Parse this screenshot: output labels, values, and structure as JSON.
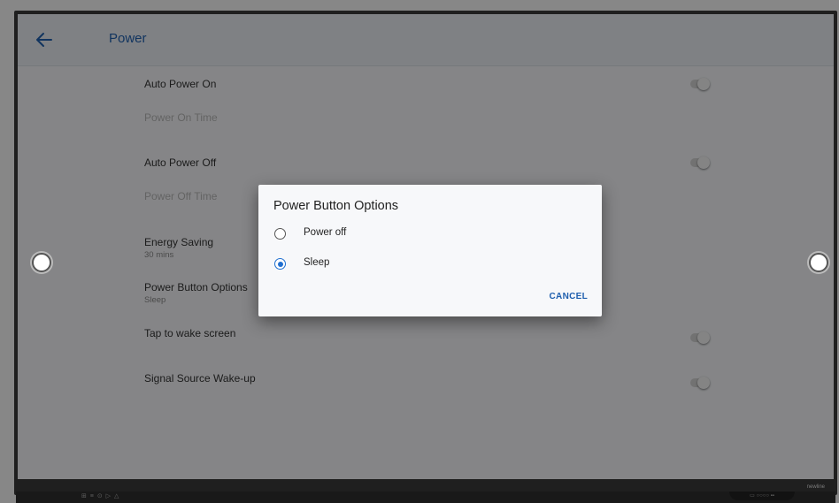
{
  "header": {
    "title": "Power",
    "back_icon": "arrow-left-icon"
  },
  "settings": {
    "auto_power_on": "Auto Power On",
    "power_on_time": "Power On Time",
    "auto_power_off": "Auto Power Off",
    "power_off_time": "Power Off Time",
    "energy_saving": "Energy Saving",
    "energy_saving_value": "30 mins",
    "power_button_options": "Power Button Options",
    "power_button_value": "Sleep",
    "tap_to_wake": "Tap to wake screen",
    "signal_wake": "Signal Source Wake-up"
  },
  "dialog": {
    "title": "Power Button Options",
    "options": [
      {
        "label": "Power off",
        "selected": false
      },
      {
        "label": "Sleep",
        "selected": true
      }
    ],
    "cancel_label": "CANCEL"
  },
  "device": {
    "brand": "newline",
    "bottom_icons": "⊞ ≡ ⊙ ▷ △",
    "ports": "▭ ○○○○ ▪▪"
  },
  "colors": {
    "accent": "#1f5fae",
    "radio_selected": "#1f6fd0"
  }
}
